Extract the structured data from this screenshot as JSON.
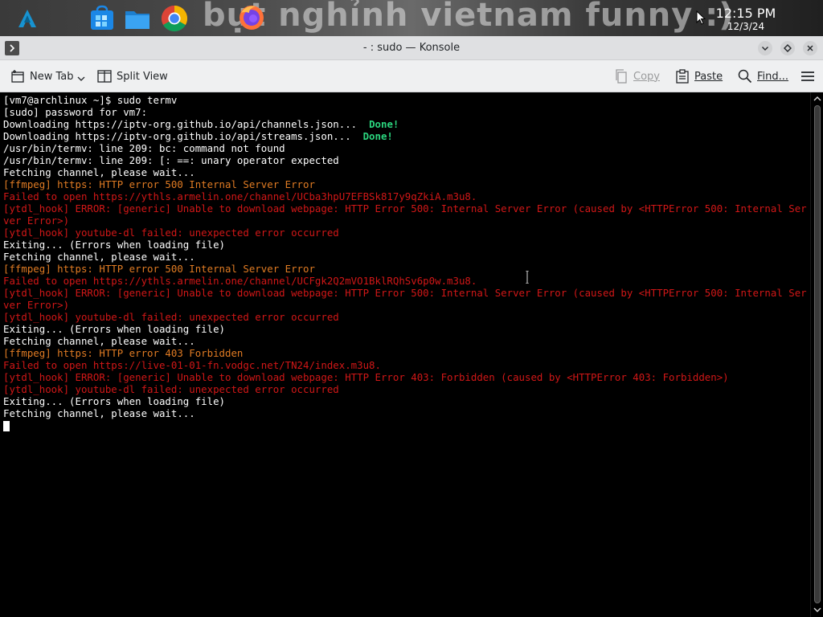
{
  "taskbar": {
    "wallpaper_text": "bựt nghỉnh vietnam funny :)",
    "clock_time": "12:15 PM",
    "clock_date": "12/3/24",
    "apps": [
      "launcher-icon",
      "store-icon",
      "files-icon",
      "chrome-icon",
      "firefox-icon"
    ]
  },
  "window": {
    "title": "- : sudo — Konsole"
  },
  "toolbar": {
    "new_tab_label": "New Tab",
    "split_view_label": "Split View",
    "copy_label": "Copy",
    "paste_label": "Paste",
    "find_label": "Find..."
  },
  "colors": {
    "default": "#ffffff",
    "orange": "#e07b23",
    "red": "#d11717",
    "green": "#2bd57e"
  },
  "terminal": {
    "lines": [
      {
        "parts": [
          {
            "text": "[vm7@archlinux ~]$ sudo termv",
            "c": "default"
          }
        ]
      },
      {
        "parts": [
          {
            "text": "[sudo] password for vm7:",
            "c": "default"
          }
        ]
      },
      {
        "parts": [
          {
            "text": "Downloading https://iptv-org.github.io/api/channels.json...  ",
            "c": "default"
          },
          {
            "text": "Done!",
            "c": "green"
          }
        ]
      },
      {
        "parts": [
          {
            "text": "Downloading https://iptv-org.github.io/api/streams.json...  ",
            "c": "default"
          },
          {
            "text": "Done!",
            "c": "green"
          }
        ]
      },
      {
        "parts": [
          {
            "text": "/usr/bin/termv: line 209: bc: command not found",
            "c": "default"
          }
        ]
      },
      {
        "parts": [
          {
            "text": "/usr/bin/termv: line 209: [: ==: unary operator expected",
            "c": "default"
          }
        ]
      },
      {
        "parts": [
          {
            "text": "Fetching channel, please wait...",
            "c": "default"
          }
        ]
      },
      {
        "parts": [
          {
            "text": "[ffmpeg] https: HTTP error 500 Internal Server Error",
            "c": "orange"
          }
        ]
      },
      {
        "parts": [
          {
            "text": "Failed to open https://ythls.armelin.one/channel/UCba3hpU7EFBSk817y9qZkiA.m3u8.",
            "c": "red"
          }
        ]
      },
      {
        "parts": [
          {
            "text": "[ytdl_hook] ERROR: [generic] Unable to download webpage: HTTP Error 500: Internal Server Error (caused by <HTTPError 500: Internal Server Error>)",
            "c": "red"
          }
        ]
      },
      {
        "parts": [
          {
            "text": "[ytdl_hook] youtube-dl failed: unexpected error occurred",
            "c": "red"
          }
        ]
      },
      {
        "parts": [
          {
            "text": "Exiting... (Errors when loading file)",
            "c": "default"
          }
        ]
      },
      {
        "parts": [
          {
            "text": "Fetching channel, please wait...",
            "c": "default"
          }
        ]
      },
      {
        "parts": [
          {
            "text": "[ffmpeg] https: HTTP error 500 Internal Server Error",
            "c": "orange"
          }
        ]
      },
      {
        "parts": [
          {
            "text": "Failed to open https://ythls.armelin.one/channel/UCFgk2Q2mVO1BklRQhSv6p0w.m3u8.",
            "c": "red"
          }
        ]
      },
      {
        "parts": [
          {
            "text": "[ytdl_hook] ERROR: [generic] Unable to download webpage: HTTP Error 500: Internal Server Error (caused by <HTTPError 500: Internal Server Error>)",
            "c": "red"
          }
        ]
      },
      {
        "parts": [
          {
            "text": "[ytdl_hook] youtube-dl failed: unexpected error occurred",
            "c": "red"
          }
        ]
      },
      {
        "parts": [
          {
            "text": "Exiting... (Errors when loading file)",
            "c": "default"
          }
        ]
      },
      {
        "parts": [
          {
            "text": "Fetching channel, please wait...",
            "c": "default"
          }
        ]
      },
      {
        "parts": [
          {
            "text": "[ffmpeg] https: HTTP error 403 Forbidden",
            "c": "orange"
          }
        ]
      },
      {
        "parts": [
          {
            "text": "Failed to open https://live-01-01-fn.vodgc.net/TN24/index.m3u8.",
            "c": "red"
          }
        ]
      },
      {
        "parts": [
          {
            "text": "[ytdl_hook] ERROR: [generic] Unable to download webpage: HTTP Error 403: Forbidden (caused by <HTTPError 403: Forbidden>)",
            "c": "red"
          }
        ]
      },
      {
        "parts": [
          {
            "text": "[ytdl_hook] youtube-dl failed: unexpected error occurred",
            "c": "red"
          }
        ]
      },
      {
        "parts": [
          {
            "text": "Exiting... (Errors when loading file)",
            "c": "default"
          }
        ]
      },
      {
        "parts": [
          {
            "text": "Fetching channel, please wait...",
            "c": "default"
          }
        ]
      }
    ]
  }
}
